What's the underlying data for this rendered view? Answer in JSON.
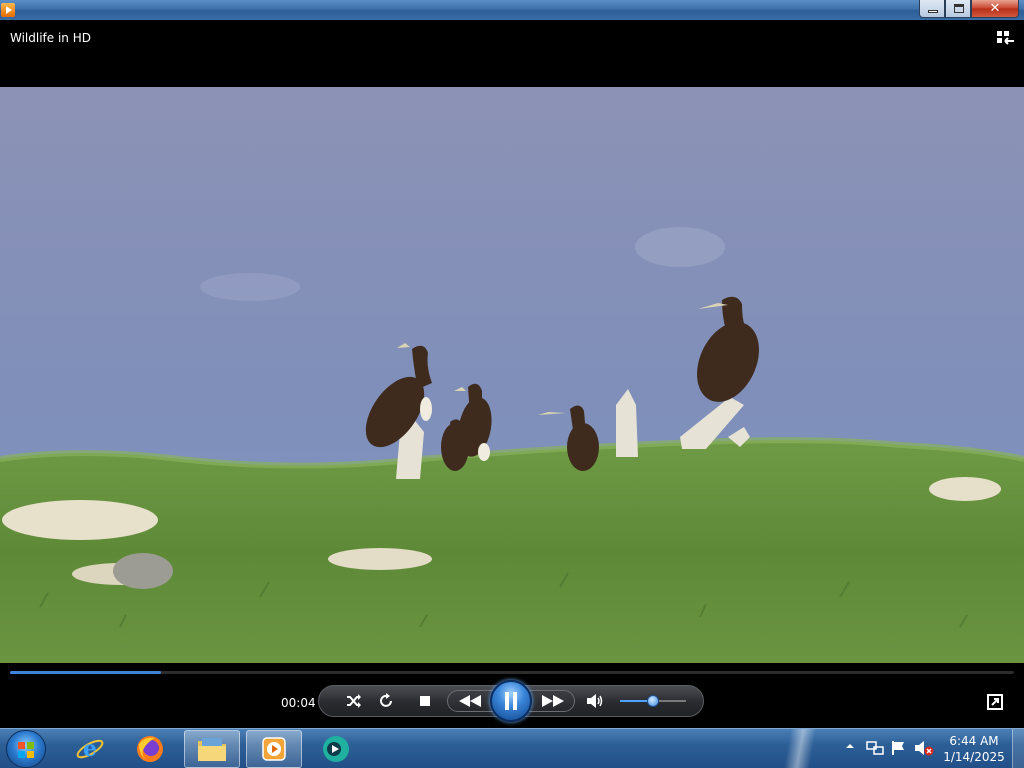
{
  "window": {
    "title": "Wildlife in HD",
    "close_label": "✕",
    "buttons": [
      "minimize",
      "maximize",
      "close"
    ]
  },
  "player": {
    "elapsed_time": "00:04",
    "playback_state": "playing",
    "seek_progress_percent": 15,
    "volume_percent": 50,
    "icons": [
      "shuffle-icon",
      "repeat-icon",
      "stop-icon",
      "previous-icon",
      "pause-icon",
      "next-icon",
      "speaker-icon",
      "switch-to-library-icon",
      "fullscreen-icon"
    ],
    "accent_color": "#3f83d9"
  },
  "taskbar": {
    "pinned": [
      "internet-explorer-icon",
      "firefox-icon",
      "file-explorer-icon",
      "windows-media-player-icon",
      "media-center-icon"
    ],
    "active_app": "windows-media-player",
    "clock": {
      "time": "6:44 AM",
      "date": "1/14/2025"
    },
    "tray_icons": [
      "show-hidden-icons-arrow",
      "network-icon",
      "action-center-flag-icon",
      "volume-muted-icon"
    ]
  }
}
